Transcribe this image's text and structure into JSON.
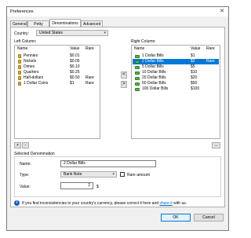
{
  "window": {
    "title": "Preferences",
    "close_glyph": "✕"
  },
  "tabs": [
    {
      "label": "General"
    },
    {
      "label": "Petty Cash"
    },
    {
      "label": "Denominations"
    },
    {
      "label": "Advanced"
    }
  ],
  "country": {
    "label": "Country:",
    "value": "United States",
    "caret": "▾"
  },
  "left_column": {
    "label": "Left Column:",
    "headers": {
      "name": "Name",
      "value": "Value",
      "rare": "Rare"
    },
    "rows": [
      {
        "name": "Pennies",
        "value": "$0.01",
        "rare": "",
        "icon": "coin-icon"
      },
      {
        "name": "Nickels",
        "value": "$0.05",
        "rare": "",
        "icon": "coin-icon"
      },
      {
        "name": "Dimes",
        "value": "$0.10",
        "rare": "",
        "icon": "coin-icon"
      },
      {
        "name": "Quarters",
        "value": "$0.25",
        "rare": "",
        "icon": "coin-icon"
      },
      {
        "name": "Half-dollars",
        "value": "$0.50",
        "rare": "Rare",
        "icon": "coin-icon"
      },
      {
        "name": "1 Dollar Coins",
        "value": "$1",
        "rare": "Rare",
        "icon": "coin-icon"
      }
    ]
  },
  "right_column": {
    "label": "Right Column:",
    "headers": {
      "name": "Name",
      "value": "Value",
      "rare": "Rare"
    },
    "rows": [
      {
        "name": "1 Dollar Bills",
        "value": "$1",
        "rare": "",
        "icon": "bill-icon"
      },
      {
        "name": "2 Dollar Bills",
        "value": "$2",
        "rare": "Rare",
        "icon": "bill-icon",
        "selected": true
      },
      {
        "name": "5 Dollar Bills",
        "value": "$5",
        "rare": "",
        "icon": "bill-icon"
      },
      {
        "name": "10 Dollar Bills",
        "value": "$10",
        "rare": "",
        "icon": "bill-icon"
      },
      {
        "name": "20 Dollar Bills",
        "value": "$20",
        "rare": "",
        "icon": "bill-icon"
      },
      {
        "name": "50 Dollar Bills",
        "value": "$50",
        "rare": "",
        "icon": "bill-icon"
      },
      {
        "name": "100 Dollar Bills",
        "value": "$100",
        "rare": "",
        "icon": "bill-icon"
      }
    ]
  },
  "move_buttons": {
    "left": "<",
    "right": ">"
  },
  "list_buttons": {
    "add": "+",
    "remove": "-",
    "more": "..."
  },
  "selected_denomination": {
    "group_label": "Selected Denomination",
    "name_label": "Name:",
    "name_value": "2 Dollar Bills",
    "type_label": "Type:",
    "type_value": "Bank Note",
    "rare_label": "Rare amount",
    "rare_checked": false,
    "value_label": "Value:",
    "value_value": "2",
    "currency_symbol": "$"
  },
  "info": {
    "icon_glyph": "i",
    "text_before": "If you find inconsistencies in your country's currency, please correct it here and ",
    "link_text": "share it",
    "text_after": " with us."
  },
  "footer": {
    "ok": "OK",
    "cancel": "Cancel"
  },
  "colors": {
    "selection": "#0078d7",
    "link": "#0066cc",
    "coin": "#d7a93a",
    "bill": "#5fae4b"
  }
}
